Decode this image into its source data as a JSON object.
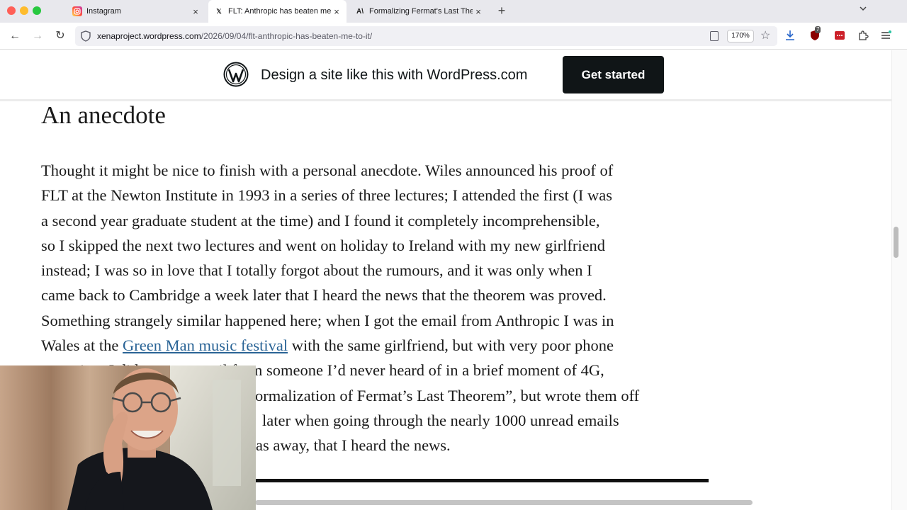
{
  "tabs": [
    {
      "title": "Instagram",
      "active": false,
      "favicon": "instagram-icon"
    },
    {
      "title": "FLT: Anthropic has beaten me to it",
      "active": true,
      "favicon": "x-icon"
    },
    {
      "title": "Formalizing Fermat's Last Theorem",
      "active": false,
      "favicon": "anthropic-icon"
    }
  ],
  "tab_close_glyph": "×",
  "tab_new_glyph": "+",
  "nav": {
    "back_glyph": "←",
    "forward_glyph": "→",
    "reload_glyph": "↻",
    "url_domain": "xenaproject.wordpress.com",
    "url_path": "/2026/09/04/flt-anthropic-has-beaten-me-to-it/",
    "zoom": "170%"
  },
  "toolbar": {
    "extension_badge": "7"
  },
  "banner": {
    "text": "Design a site like this with WordPress.com",
    "cta": "Get started"
  },
  "article": {
    "heading": "An anecdote",
    "lines": [
      "Thought it might be nice to finish with a personal anecdote. Wiles announced his proof of",
      "FLT at the Newton Institute in 1993 in a series of three lectures; I attended the first (I was",
      "a second year graduate student at the time) and I found it completely incomprehensible,",
      "so I skipped the next two lectures and went on holiday to Ireland with my new girlfriend",
      "instead; I was so in love that I totally forgot about the rumours, and it was only when I",
      "came back to Cambridge a week later that I heard the news that the theorem was proved.",
      "Something strangely similar happened here; when I got the email from Anthropic I was in"
    ],
    "line8_before": "Wales at the ",
    "line8_link": "Green Man music festival",
    "line8_after": " with the same girlfriend, but with very poor phone",
    "partial_lines": [
      "reception: I did spot an email from someone I’d never heard of in a brief moment of 4G,",
      "ormalization of Fermat’s Last Theorem”, but wrote them off",
      "later when going through the nearly 1000 unread emails",
      "as away, that I heard the news."
    ]
  },
  "colors": {
    "link": "#2a6496",
    "cta_bg": "#101517",
    "tabbar_bg": "#e8e8ed"
  }
}
